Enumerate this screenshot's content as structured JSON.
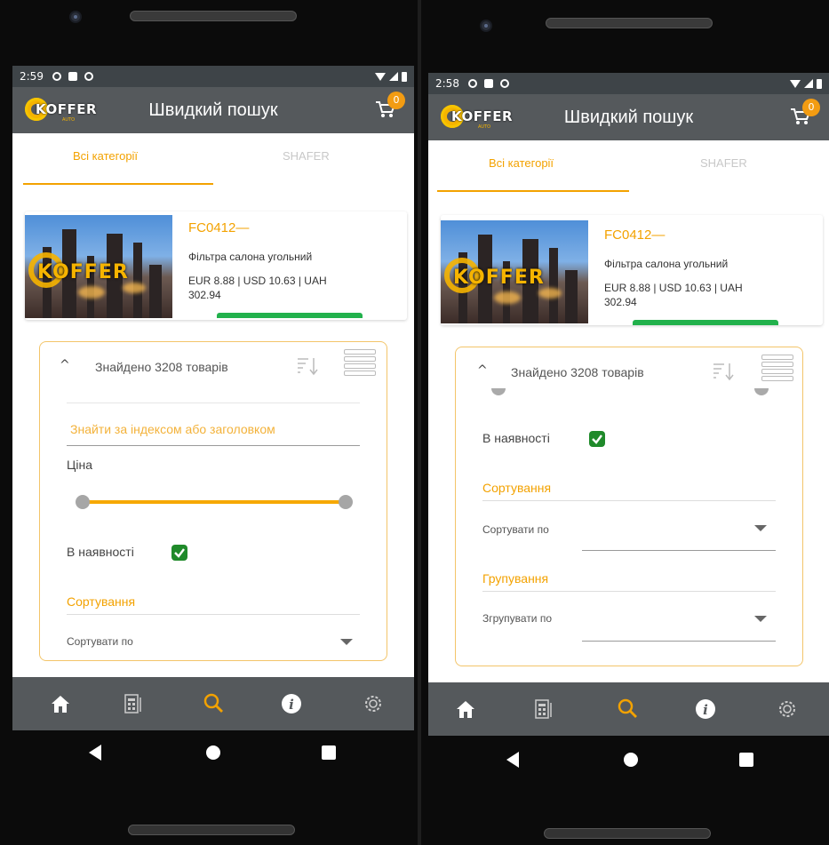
{
  "app": {
    "title": "Швидкий пошук",
    "logo_text": "KOFFER",
    "logo_sub": "AUTO",
    "cart_count": "0",
    "accent_color": "#f3a200",
    "bar_color": "#55595c"
  },
  "tabs": [
    {
      "label": "Всі категорії",
      "active": true
    },
    {
      "label": "SHAFER",
      "active": false
    }
  ],
  "product": {
    "code": "FC0412—",
    "name": "Фільтра салона угольний",
    "price": "EUR 8.88 | USD 10.63 | UAH 302.94",
    "image_watermark": "KOFFER"
  },
  "filter": {
    "found": "Знайдено 3208 товарів",
    "search_placeholder": "Знайти за індексом або заголовком",
    "price_label": "Ціна",
    "in_stock_label": "В наявності",
    "sort_section": "Сортування",
    "sort_by": "Сортувати по",
    "group_section": "Групування",
    "group_by": "Згрупувати по"
  },
  "phones": [
    {
      "time": "2:59"
    },
    {
      "time": "2:58"
    }
  ],
  "bottom_nav": [
    "home-icon",
    "catalog-icon",
    "search-icon",
    "info-icon",
    "settings-icon"
  ]
}
